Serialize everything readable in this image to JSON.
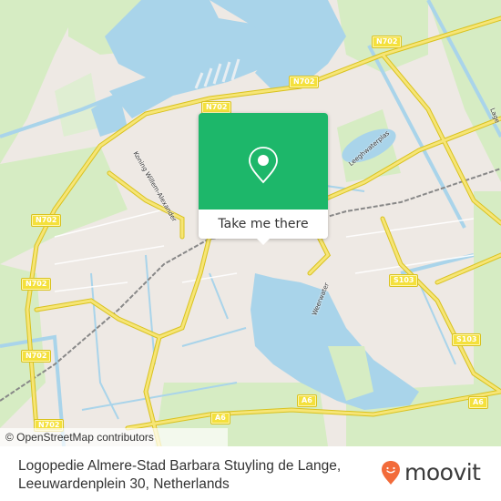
{
  "map": {
    "colors": {
      "water": "#a9d4ea",
      "land": "#eee9e4",
      "green": "#d6ecc3",
      "road_major": "#f4e03c",
      "shield": "#f4e03c"
    },
    "road_shields": [
      {
        "id": "n702-top-right",
        "label": "N702"
      },
      {
        "id": "n702-center",
        "label": "N702"
      },
      {
        "id": "n702-upper-left",
        "label": "N702"
      },
      {
        "id": "n702-left-1",
        "label": "N702"
      },
      {
        "id": "n702-left-2",
        "label": "N702"
      },
      {
        "id": "n702-left-3",
        "label": "N702"
      },
      {
        "id": "n702-bottom",
        "label": "N702"
      },
      {
        "id": "s103-upper",
        "label": "S103"
      },
      {
        "id": "s103-lower",
        "label": "S103"
      },
      {
        "id": "a6-left",
        "label": "A6"
      },
      {
        "id": "a6-center",
        "label": "A6"
      },
      {
        "id": "a6-right",
        "label": "A6"
      }
    ],
    "street_labels": [
      {
        "id": "koning-willem",
        "label": "Koning Willem-Alexander"
      },
      {
        "id": "leeghwaterplas",
        "label": "Leeghwaterplas"
      },
      {
        "id": "weerwater",
        "label": "Weerwater"
      },
      {
        "id": "lage-vaart",
        "label": "Lage"
      }
    ],
    "attribution": "© OpenStreetMap contributors"
  },
  "popup": {
    "icon": "location-pin-icon",
    "button_label": "Take me there",
    "color": "#1db76a"
  },
  "footer": {
    "address_line1": "Logopedie Almere-Stad Barbara Stuyling de Lange,",
    "address_line2": "Leeuwardenplein 30, Netherlands",
    "brand": "moovit",
    "brand_color": "#f26b3a"
  }
}
